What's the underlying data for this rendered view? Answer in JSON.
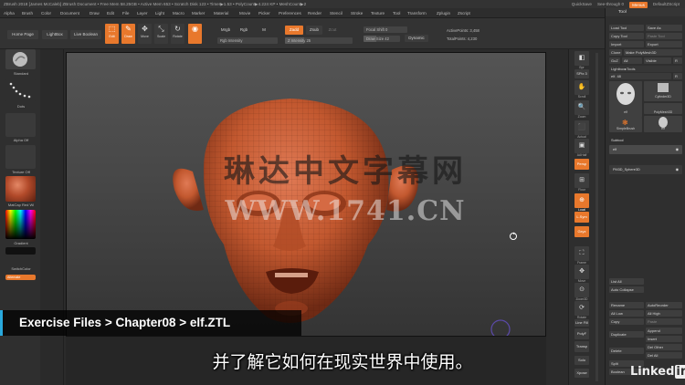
{
  "titlebar": {
    "left": "ZBrush 2018 [James McCaleb]   ZBrush Document    • Free Mem 58.25GB • Active Mem 653 • Scratch Disk 123 • Timer▶1.53 • PolyCount▶4.224 KP • MeshCount▶2",
    "quicksave": "QuickSave",
    "seethrough": "See-through  0",
    "menus_btn": "Menus",
    "default_script": "DefaultZScript"
  },
  "menubar": [
    "Alpha",
    "Brush",
    "Color",
    "Document",
    "Draw",
    "Edit",
    "File",
    "Layer",
    "Light",
    "Macro",
    "Marker",
    "Material",
    "Movie",
    "Picker",
    "Preferences",
    "Render",
    "Stencil",
    "Stroke",
    "Texture",
    "Tool",
    "Transform",
    "Zplugin",
    "Zscript"
  ],
  "toolbar": {
    "home_page": "Home Page",
    "lightbox": "LightBox",
    "live_boolean": "Live Boolean",
    "edit": "Edit",
    "draw": "Draw",
    "move": "Move",
    "scale": "Scale",
    "rotate": "Rotate",
    "mrgb": "Mrgb",
    "rgb": "Rgb",
    "m": "M",
    "zadd": "Zadd",
    "zsub": "Zsub",
    "zcut": "Zcut",
    "rgb_intensity": "Rgb Intensity",
    "z_intensity": "Z Intensity 25",
    "focal_shift": "Focal Shift 0",
    "draw_size": "Draw Size 42",
    "dynamic": "Dynamic",
    "active_points": "ActivePoints: 3,458",
    "total_points": "TotalPoints: 4,230"
  },
  "left_tray": {
    "standard": "Standard",
    "dots": "Dots",
    "alpha_off": "Alpha Off",
    "texture_off": "Texture Off",
    "matcap": "MatCap Red Wi",
    "gradient": "Gradient",
    "switch_color": "SwitchColor",
    "alternate": "Alternate"
  },
  "right_tray": [
    "Bpr",
    "SPix 3",
    "Scroll",
    "Zoom",
    "Actual",
    "AAHalf",
    "Persp",
    "Floor",
    "Local",
    "L.Sym",
    "Gxyz",
    "Frame",
    "Move",
    "Zoom3D",
    "Rotate",
    "Line Fill",
    "PolyF",
    "Transp",
    "Solo",
    "Xpose"
  ],
  "tool_panel": {
    "title": "Tool",
    "load_tool": "Load Tool",
    "save_as": "Save As",
    "copy_tool": "Copy Tool",
    "paste_tool": "Paste Tool",
    "import": "Import",
    "export": "Export",
    "clone": "Clone",
    "make_polymesh": "Make PolyMesh3D",
    "goz": "GoZ",
    "all": "All",
    "visible": "Visible",
    "r": "R",
    "lightbox_tools": "Lightbox▸Tools",
    "elf_label": "elf. 48",
    "r2": "R",
    "thumb_elf": "elf",
    "thumb_cyl": "Cylinder3D",
    "thumb_simple": "SimpleBrush",
    "thumb_poly": "PolyMesh3D",
    "thumb_elf2": "elf",
    "subtool": "Subtool",
    "sub_elf": "elf",
    "sub_sphere": "PM3D_Sphere3D",
    "list_all": "List All",
    "auto_collapse": "Auto Collapse",
    "rename": "Rename",
    "auto_reorder": "AutoReorder",
    "all_low": "All Low",
    "all_high": "All High",
    "copy": "Copy",
    "paste": "Paste",
    "duplicate": "Duplicate",
    "append": "Append",
    "insert": "Insert",
    "delete": "Delete",
    "del_other": "Del Other",
    "del_all": "Del All",
    "split": "Split",
    "boolean": "Boolean"
  },
  "overlay": {
    "watermark_cn": "琳达中文字幕网",
    "watermark_url": "WWW.1741.CN",
    "exercise_files": "Exercise Files > Chapter08 > elf.ZTL",
    "subtitle": "并了解它如何在现实世界中使用。",
    "logo_text": "Linked",
    "logo_in": "in"
  },
  "colors": {
    "accent": "#e8782c",
    "head": "#c2582f",
    "banner_border": "#29a8dc"
  }
}
